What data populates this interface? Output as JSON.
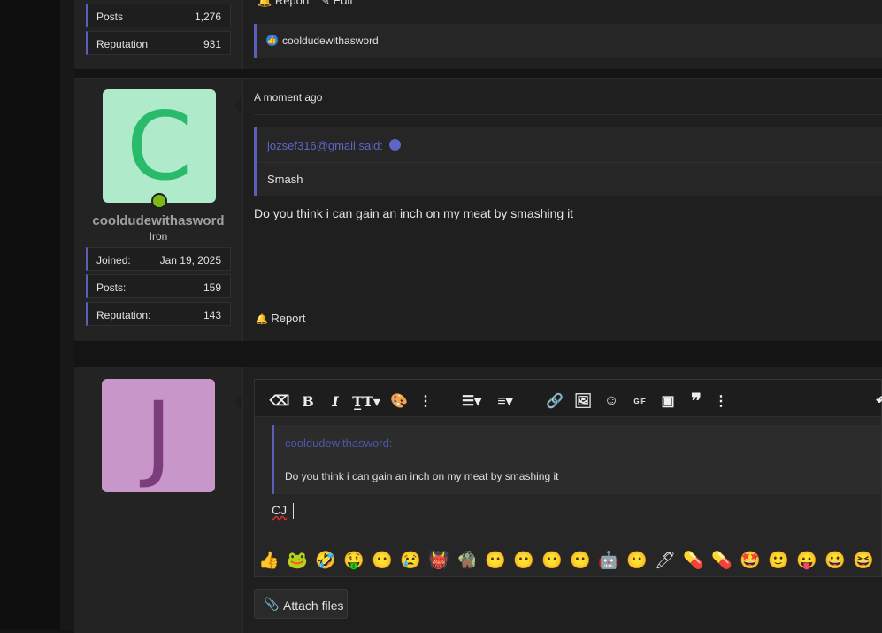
{
  "post1": {
    "stats": [
      {
        "label": "Posts",
        "value": "1,276"
      },
      {
        "label": "Reputation",
        "value": "931"
      }
    ],
    "actions": {
      "report": "Report",
      "edit": "Edit"
    },
    "reaction_user": "cooldudewithasword"
  },
  "post2": {
    "avatar_letter": "C",
    "avatar_bg": "#afeacb",
    "avatar_fg": "#29bb6b",
    "username": "cooldudewithasword",
    "rank": "Iron",
    "stats": [
      {
        "label": "Joined:",
        "value": "Jan 19, 2025"
      },
      {
        "label": "Posts:",
        "value": "159"
      },
      {
        "label": "Reputation:",
        "value": "143"
      }
    ],
    "time": "A moment ago",
    "quote_author": "jozsef316@gmail said:",
    "quote_text": "Smash",
    "body": "Do you think i can gain an inch on my meat by smashing it",
    "report": "Report"
  },
  "reply": {
    "avatar_letter": "J",
    "avatar_bg": "#c996c9",
    "avatar_fg": "#7c3d7c",
    "quote_author": "cooldudewithasword:",
    "quote_text": "Do you think i can gain an inch on my meat by smashing it",
    "typed_text": "CJ",
    "attach_label": "Attach files",
    "emojis": [
      "👍",
      "🐸",
      "🤣",
      "🤑",
      "😶",
      "😢",
      "👹",
      "🧌",
      "😶",
      "😶",
      "😶",
      "😶",
      "🤖",
      "😶",
      "🖊",
      "💊",
      "💊",
      "🤩",
      "🙂",
      "😛",
      "😀",
      "😆",
      "🤣"
    ]
  }
}
